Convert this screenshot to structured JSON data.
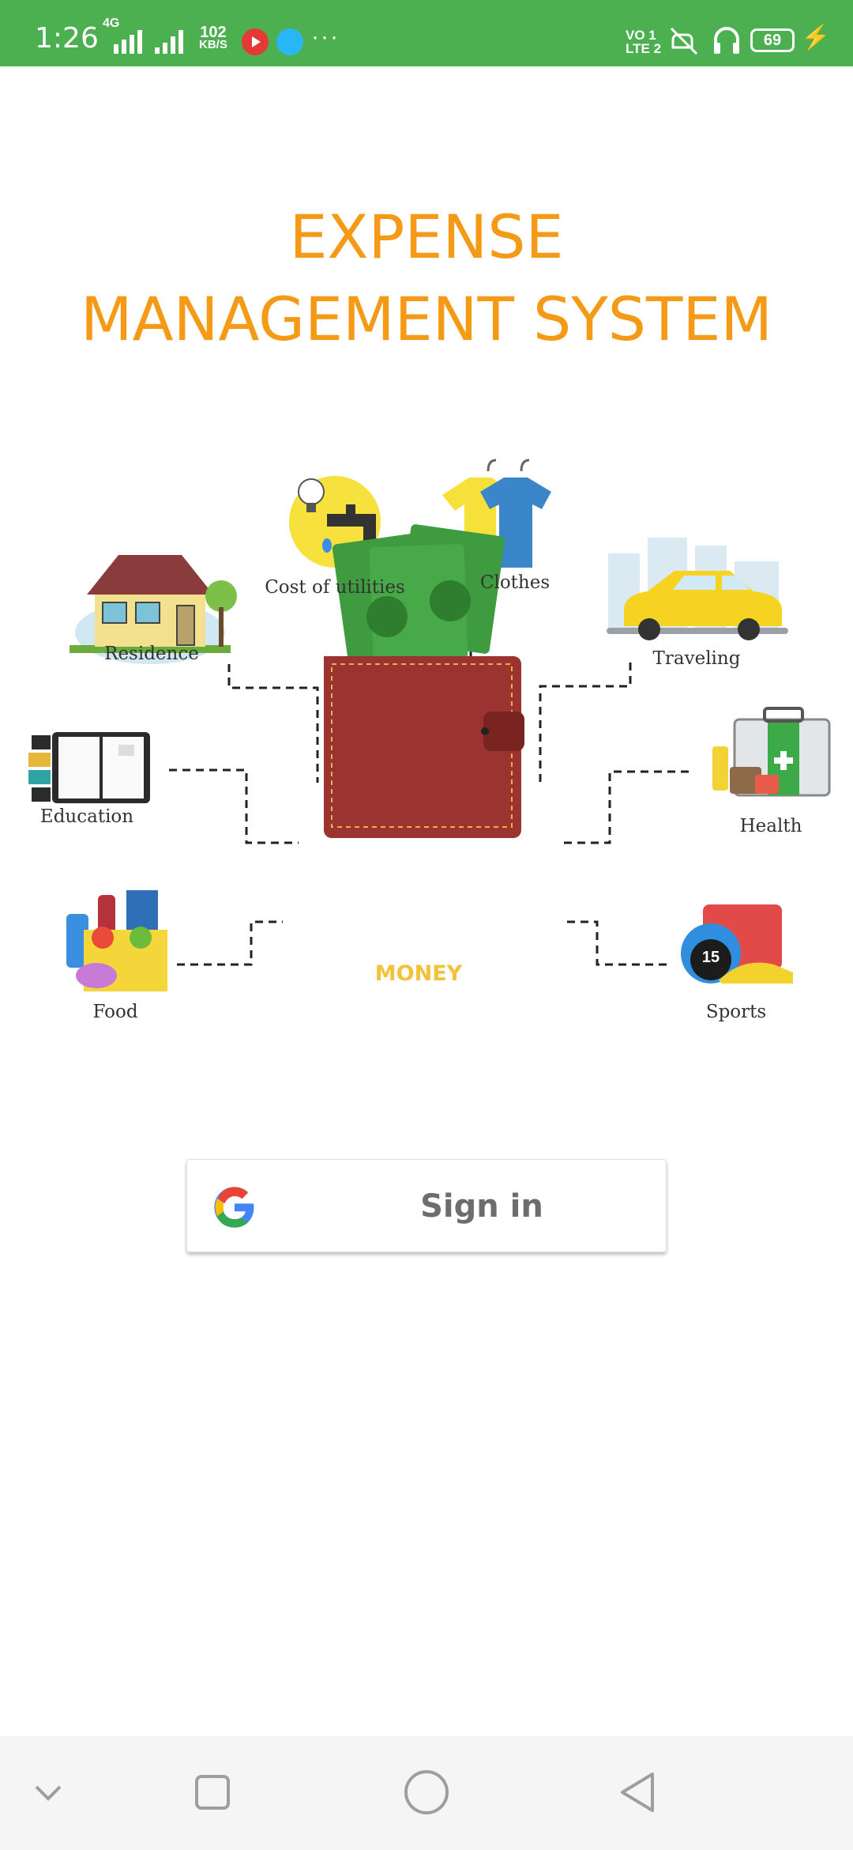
{
  "status_bar": {
    "time": "1:26",
    "network": "4G",
    "speed_value": "102",
    "speed_unit": "KB/S",
    "more": "···",
    "volte_line1": "VO 1",
    "volte_line2": "LTE 2",
    "battery": "69"
  },
  "title": {
    "line1": "EXPENSE",
    "line2": "MANAGEMENT SYSTEM"
  },
  "illustration": {
    "center_label": "MONEY",
    "categories": {
      "residence": "Residence",
      "utilities": "Cost of utilities",
      "clothes": "Clothes",
      "traveling": "Traveling",
      "education": "Education",
      "health": "Health",
      "food": "Food",
      "sports": "Sports"
    },
    "sports_badge": "15"
  },
  "signin": {
    "label": "Sign in"
  },
  "colors": {
    "status_bar": "#4caf50",
    "title": "#f59a16",
    "money_green": "#3f9b3f",
    "wallet": "#9b3431"
  }
}
